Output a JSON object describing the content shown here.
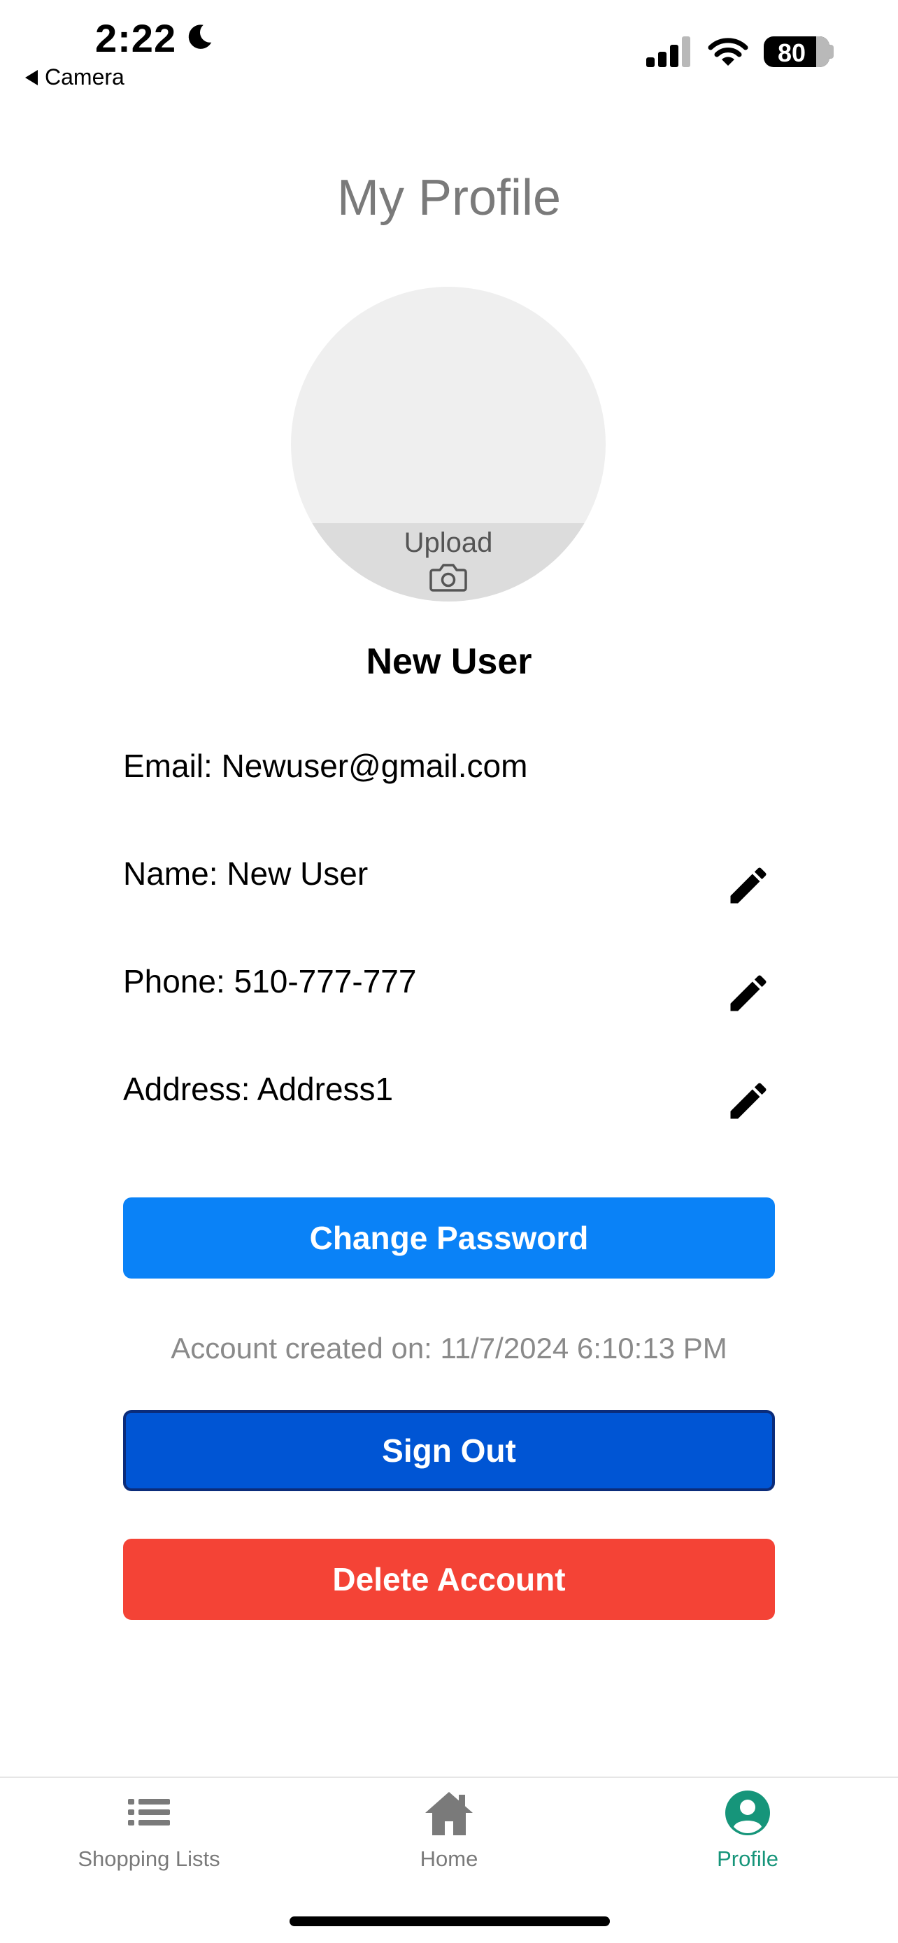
{
  "status_bar": {
    "time": "2:22",
    "back_app": "Camera",
    "battery": "80"
  },
  "header": {
    "title": "My Profile"
  },
  "avatar": {
    "upload_label": "Upload"
  },
  "user": {
    "display_name": "New User"
  },
  "info": {
    "email": "Email: Newuser@gmail.com",
    "name": "Name: New User",
    "phone": "Phone: 510-777-777",
    "address": "Address: Address1"
  },
  "actions": {
    "change_password": "Change Password",
    "account_created": "Account created on: 11/7/2024 6:10:13 PM",
    "sign_out": "Sign Out",
    "delete_account": "Delete Account"
  },
  "tabs": [
    {
      "label": "Shopping Lists",
      "icon": "list-icon",
      "active": false
    },
    {
      "label": "Home",
      "icon": "home-icon",
      "active": false
    },
    {
      "label": "Profile",
      "icon": "profile-icon",
      "active": true
    }
  ],
  "colors": {
    "primary_blue": "#0a82f7",
    "signout_blue": "#0055d4",
    "danger_red": "#f44336",
    "active_tab": "#16957a",
    "inactive_tab": "#7a7a7a"
  }
}
